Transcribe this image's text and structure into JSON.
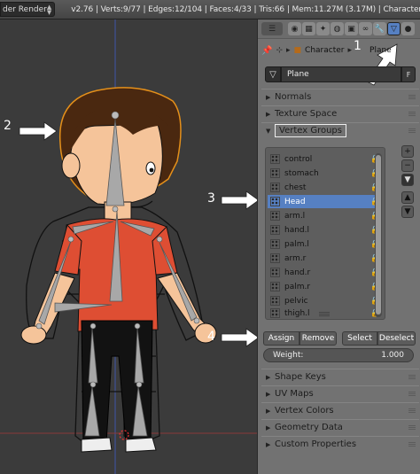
{
  "header": {
    "engine_label": "der Render",
    "stats": "v2.76 | Verts:9/77 | Edges:12/104 | Faces:4/33 | Tris:66 | Mem:11.27M (3.17M) | Character"
  },
  "properties": {
    "breadcrumb": [
      "Character",
      "Plane"
    ],
    "mesh_name": "Plane",
    "fake_user_label": "F",
    "sections_top": [
      "Normals",
      "Texture Space"
    ],
    "vertex_groups_title": "Vertex Groups",
    "groups": [
      "control",
      "stomach",
      "chest",
      "Head",
      "arm.l",
      "hand.l",
      "palm.l",
      "arm.r",
      "hand.r",
      "palm.r",
      "pelvic",
      "thigh.l"
    ],
    "active_group": "Head",
    "buttons": {
      "assign": "Assign",
      "remove": "Remove",
      "select": "Select",
      "deselect": "Deselect"
    },
    "weight_label": "Weight:",
    "weight_value": "1.000",
    "sections_bottom": [
      "Shape Keys",
      "UV Maps",
      "Vertex Colors",
      "Geometry Data",
      "Custom Properties"
    ]
  },
  "callouts": [
    "1",
    "2",
    "3",
    "4"
  ],
  "colors": {
    "accent_selection": "#5680c2",
    "viewport_bg": "#3b3b3b",
    "panel_bg": "#727272",
    "callout": "#ffffff"
  }
}
